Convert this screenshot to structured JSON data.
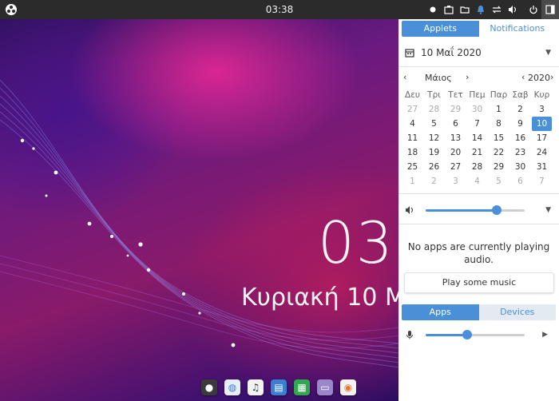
{
  "topbar": {
    "clock": "03:38",
    "logo_icon": "budgie-logo-icon",
    "tray_icons": [
      "record-dot-icon",
      "screenshot-icon",
      "folder-icon",
      "notification-bell-icon",
      "network-arrows-icon",
      "volume-icon",
      "power-icon",
      "sidebar-toggle-icon"
    ]
  },
  "desktop": {
    "time": "03:",
    "date": "Κυριακή 10 Μ"
  },
  "dock": {
    "apps": [
      {
        "name": "budgie-app",
        "color": "#3a3a3a"
      },
      {
        "name": "browser-app",
        "color": "#e8eef6"
      },
      {
        "name": "music-app",
        "color": "#f2f2f2"
      },
      {
        "name": "document-app",
        "color": "#3a7fd0"
      },
      {
        "name": "spreadsheet-app",
        "color": "#2fa84f"
      },
      {
        "name": "files-app",
        "color": "#9a86c8"
      },
      {
        "name": "firefox-app",
        "color": "#f2f2f2"
      }
    ]
  },
  "panel": {
    "top_tabs": {
      "applets": "Applets",
      "notifications": "Notifications"
    },
    "date_field": "10 Μαΐ 2020",
    "calendar": {
      "month": "Μάιος",
      "year": "2020",
      "prev_month": "‹",
      "next_month": "›",
      "prev_year": "‹",
      "next_year": "›",
      "weekdays": [
        "Δευ",
        "Τρι",
        "Τετ",
        "Πεμ",
        "Παρ",
        "Σαβ",
        "Κυρ"
      ],
      "weeks": [
        [
          "27",
          "28",
          "29",
          "30",
          "1",
          "2",
          "3"
        ],
        [
          "4",
          "5",
          "6",
          "7",
          "8",
          "9",
          "10"
        ],
        [
          "11",
          "12",
          "13",
          "14",
          "15",
          "16",
          "17"
        ],
        [
          "18",
          "19",
          "20",
          "21",
          "22",
          "23",
          "24"
        ],
        [
          "25",
          "26",
          "27",
          "28",
          "29",
          "30",
          "31"
        ],
        [
          "1",
          "2",
          "3",
          "4",
          "5",
          "6",
          "7"
        ]
      ],
      "selected_day": "10"
    },
    "volume_level": 0.72,
    "no_apps_text": "No apps are currently playing audio.",
    "play_button": "Play some music",
    "bottom_tabs": {
      "apps": "Apps",
      "devices": "Devices"
    },
    "mic_level": 0.42
  },
  "colors": {
    "accent": "#4a90d9",
    "topbar": "#2b2b2b",
    "panel_bg": "#ffffff"
  }
}
